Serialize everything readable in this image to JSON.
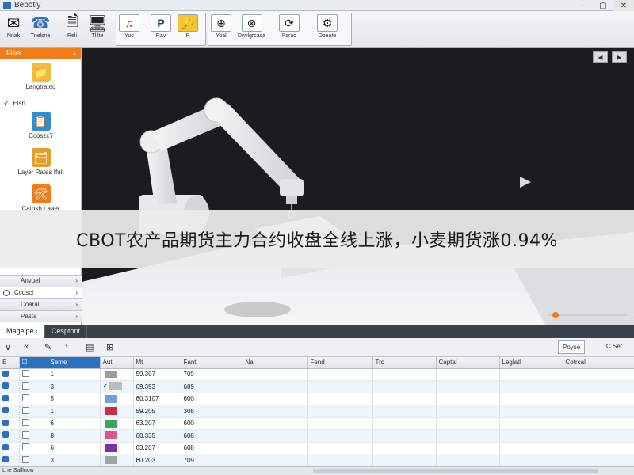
{
  "window": {
    "title": "Bebotly",
    "controls": [
      "–",
      "▢",
      "✕"
    ]
  },
  "toolbar": {
    "items": [
      {
        "label": "Nnak",
        "icon": "mail-icon",
        "glyph": "✉"
      },
      {
        "label": "Tnelsne",
        "icon": "phone-icon",
        "glyph": "☎"
      },
      {
        "label": "Reli",
        "icon": "document-icon",
        "glyph": "🗎"
      },
      {
        "label": "Tlilte",
        "icon": "monitor-icon",
        "glyph": "🖥"
      },
      {
        "label": "Yuc",
        "icon": "music-note-icon",
        "glyph": "♫"
      },
      {
        "label": "Rav",
        "icon": "pointer-icon",
        "glyph": "P"
      },
      {
        "label": "P",
        "icon": "key-icon",
        "glyph": "🔑"
      },
      {
        "label": "Yoal",
        "icon": "zoom-in-icon",
        "glyph": "⊕"
      },
      {
        "label": "Dnvlgrcaca",
        "icon": "zoom-fit-icon",
        "glyph": "⊗"
      },
      {
        "label": "Psrao",
        "icon": "rotate-icon",
        "glyph": "⟳"
      },
      {
        "label": "Doeate",
        "icon": "settings-icon",
        "glyph": "⚙"
      }
    ]
  },
  "leftpanel": {
    "header": "Fisel",
    "items": [
      {
        "label": "Langtrated",
        "icon": "folder-icon",
        "glyph": "📁",
        "color": "#f2b93b"
      },
      {
        "label": "Ccoszc7",
        "icon": "clipboard-icon",
        "glyph": "📋",
        "color": "#2d8fd6"
      },
      {
        "label": "Layer Rates Ifuit",
        "icon": "layers-icon",
        "glyph": "🗂",
        "color": "#e2a12c"
      },
      {
        "label": "Catnsh Laaer",
        "icon": "wrench-icon",
        "glyph": "🛠",
        "color": "#f07d18"
      }
    ],
    "checked_item": "Elsh",
    "accordion": [
      {
        "label": "Anyuel",
        "active": false
      },
      {
        "label": "Ccoscl",
        "active": true
      },
      {
        "label": "Coaral",
        "active": false
      },
      {
        "label": "Pasta",
        "active": false
      }
    ]
  },
  "viewport": {
    "nav_prev": "◀",
    "nav_next": "▶"
  },
  "banner": {
    "text": "CBOT农产品期货主力合约收盘全线上涨，小麦期货涨0.94%"
  },
  "bottomtabs": {
    "tabs": [
      "Magelpe",
      "Cesptont"
    ]
  },
  "subtoolbar": {
    "buttons": [
      "Poyse",
      "C Set"
    ]
  },
  "grid": {
    "columns": [
      "E",
      "☑",
      "Seme",
      "Aut",
      "Mt",
      "Fantl",
      "Nal",
      "Fend",
      "Tro",
      "Captal",
      "Leglatl",
      "Cotrcal"
    ],
    "rows": [
      {
        "id": "1",
        "mark": "",
        "swatch": "#9a9ea3",
        "mt": "59.307",
        "val": "709"
      },
      {
        "id": "3",
        "mark": "✓",
        "swatch": "#b8bcc0",
        "mt": "69.393",
        "val": "689"
      },
      {
        "id": "5",
        "mark": "",
        "swatch": "#6fa0d8",
        "mt": "60.3107",
        "val": "600"
      },
      {
        "id": "1",
        "mark": "",
        "swatch": "#cc2a4a",
        "mt": "59.205",
        "val": "308"
      },
      {
        "id": "6",
        "mark": "",
        "swatch": "#3ba55d",
        "mt": "63.207",
        "val": "600"
      },
      {
        "id": "8",
        "mark": "",
        "swatch": "#e0558b",
        "mt": "60.335",
        "val": "608"
      },
      {
        "id": "6",
        "mark": "",
        "swatch": "#7a2fb0",
        "mt": "63.207",
        "val": "608"
      },
      {
        "id": "3",
        "mark": "",
        "swatch": "#a0a4a9",
        "mt": "60.203",
        "val": "709"
      }
    ]
  },
  "statusbar": {
    "text": "Lne Salllnow"
  }
}
